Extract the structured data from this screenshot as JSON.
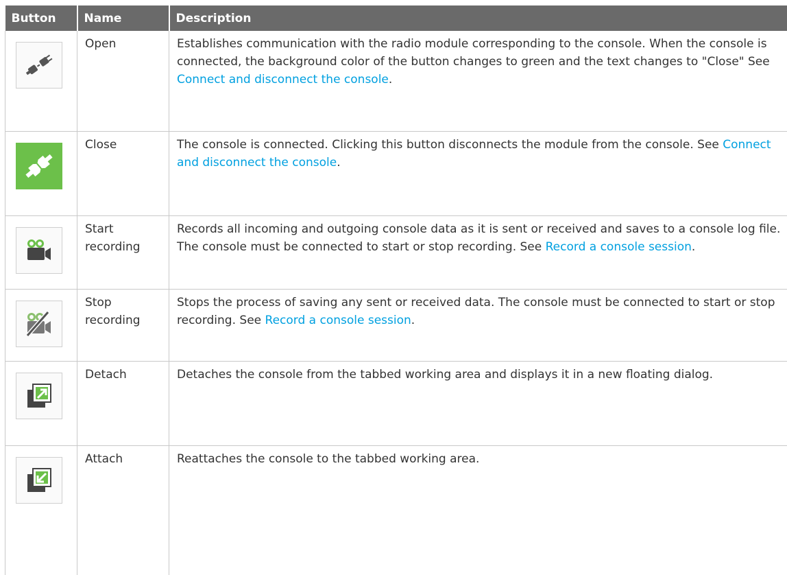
{
  "table": {
    "headers": [
      "Button",
      "Name",
      "Description"
    ],
    "rows": [
      {
        "icon": "plug-disconnected-icon",
        "name": "Open",
        "desc_before": "Establishes communication with the radio module corresponding to the console. When the console is connected, the background color of the button changes to green and the text changes to \"Close\" See ",
        "link": "Connect and disconnect the console",
        "desc_after": "."
      },
      {
        "icon": "plug-connected-icon",
        "name": "Close",
        "desc_before": "The console is connected. Clicking this button disconnects the module from the console. See ",
        "link": "Connect and disconnect the console",
        "desc_after": "."
      },
      {
        "icon": "video-camera-icon",
        "name": "Start recording",
        "desc_before": "Records all incoming and outgoing console data as it is sent or received and saves to a console log file. The console must be connected to start or stop recording. See ",
        "link": "Record a console session",
        "desc_after": "."
      },
      {
        "icon": "video-camera-off-icon",
        "name": "Stop recording",
        "desc_before": "Stops the process of saving any sent or received data. The console must be connected to start or stop recording. See ",
        "link": "Record a console session",
        "desc_after": "."
      },
      {
        "icon": "detach-window-icon",
        "name": "Detach",
        "desc_before": "Detaches the console from the tabbed working area and displays it in a new floating dialog.",
        "link": "",
        "desc_after": ""
      },
      {
        "icon": "attach-window-icon",
        "name": "Attach",
        "desc_before": "Reattaches the console to the tabbed working area.",
        "link": "",
        "desc_after": ""
      }
    ],
    "colors": {
      "header_bg": "#6a6a6a",
      "link": "#00a0e0",
      "connected_green": "#6cc04a"
    }
  }
}
